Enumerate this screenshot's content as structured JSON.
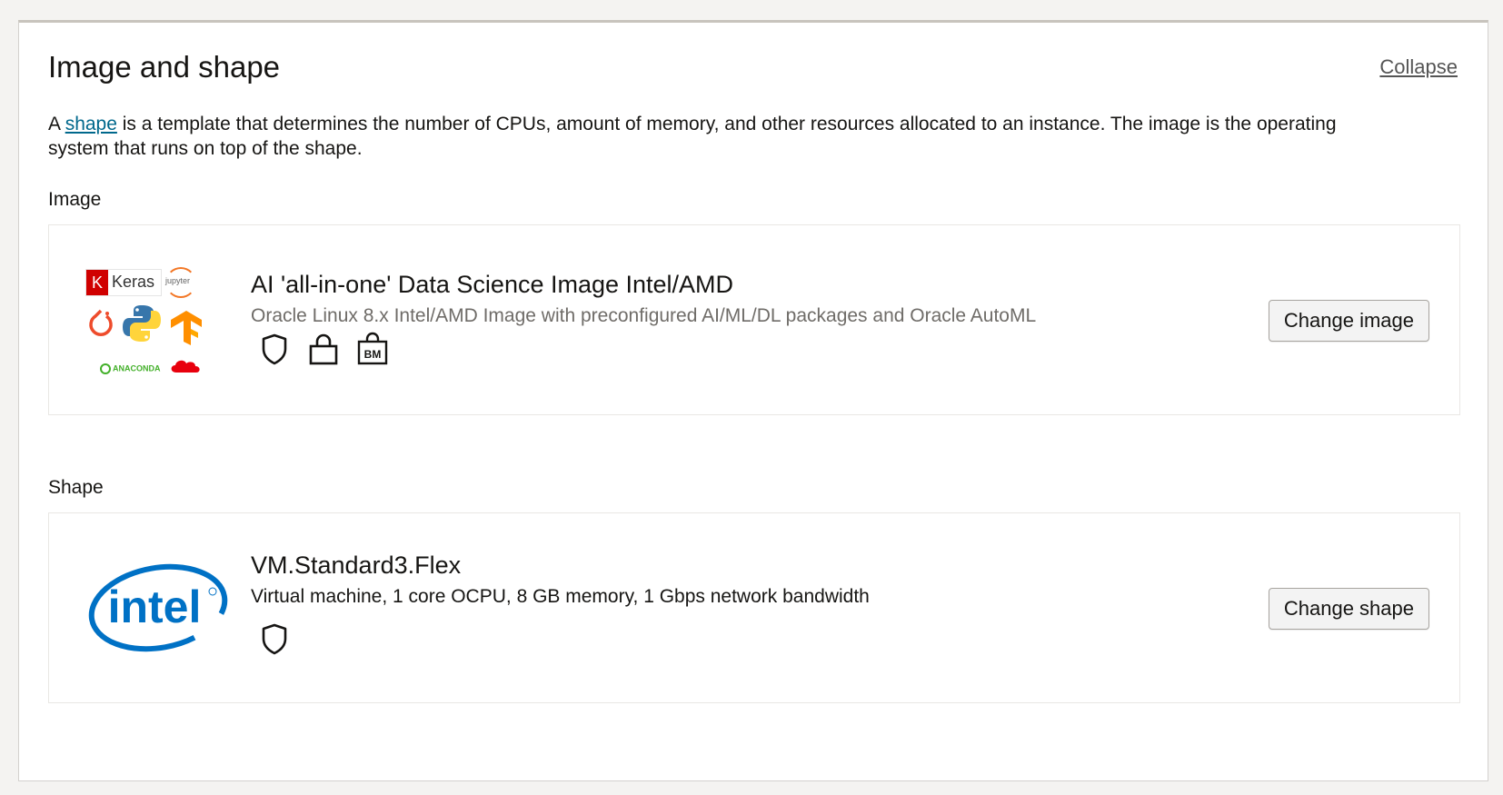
{
  "header": {
    "title": "Image and shape",
    "collapse_label": "Collapse"
  },
  "description": {
    "prefix": "A ",
    "link": "shape",
    "suffix": " is a template that determines the number of CPUs, amount of memory, and other resources allocated to an instance. The image is the operating system that runs on top of the shape."
  },
  "image": {
    "label": "Image",
    "name": "AI 'all-in-one' Data Science Image Intel/AMD",
    "subtitle": "Oracle Linux 8.x Intel/AMD Image with preconfigured AI/ML/DL packages and Oracle AutoML",
    "button": "Change image",
    "logo_texts": {
      "keras_k": "K",
      "keras": "Keras",
      "jupyter": "jupyter",
      "anaconda": "ANACONDA"
    },
    "badges": [
      "shield-icon",
      "lock-icon",
      "bare-metal-icon"
    ],
    "bm_text": "BM"
  },
  "shape": {
    "label": "Shape",
    "name": "VM.Standard3.Flex",
    "subtitle": "Virtual machine, 1 core OCPU, 8 GB memory, 1 Gbps network bandwidth",
    "button": "Change shape",
    "logo_text": "intel",
    "badges": [
      "shield-icon"
    ]
  },
  "colors": {
    "link": "#00688c",
    "muted": "#6f6c68",
    "intel_blue": "#0071c5",
    "keras_red": "#d00000"
  }
}
